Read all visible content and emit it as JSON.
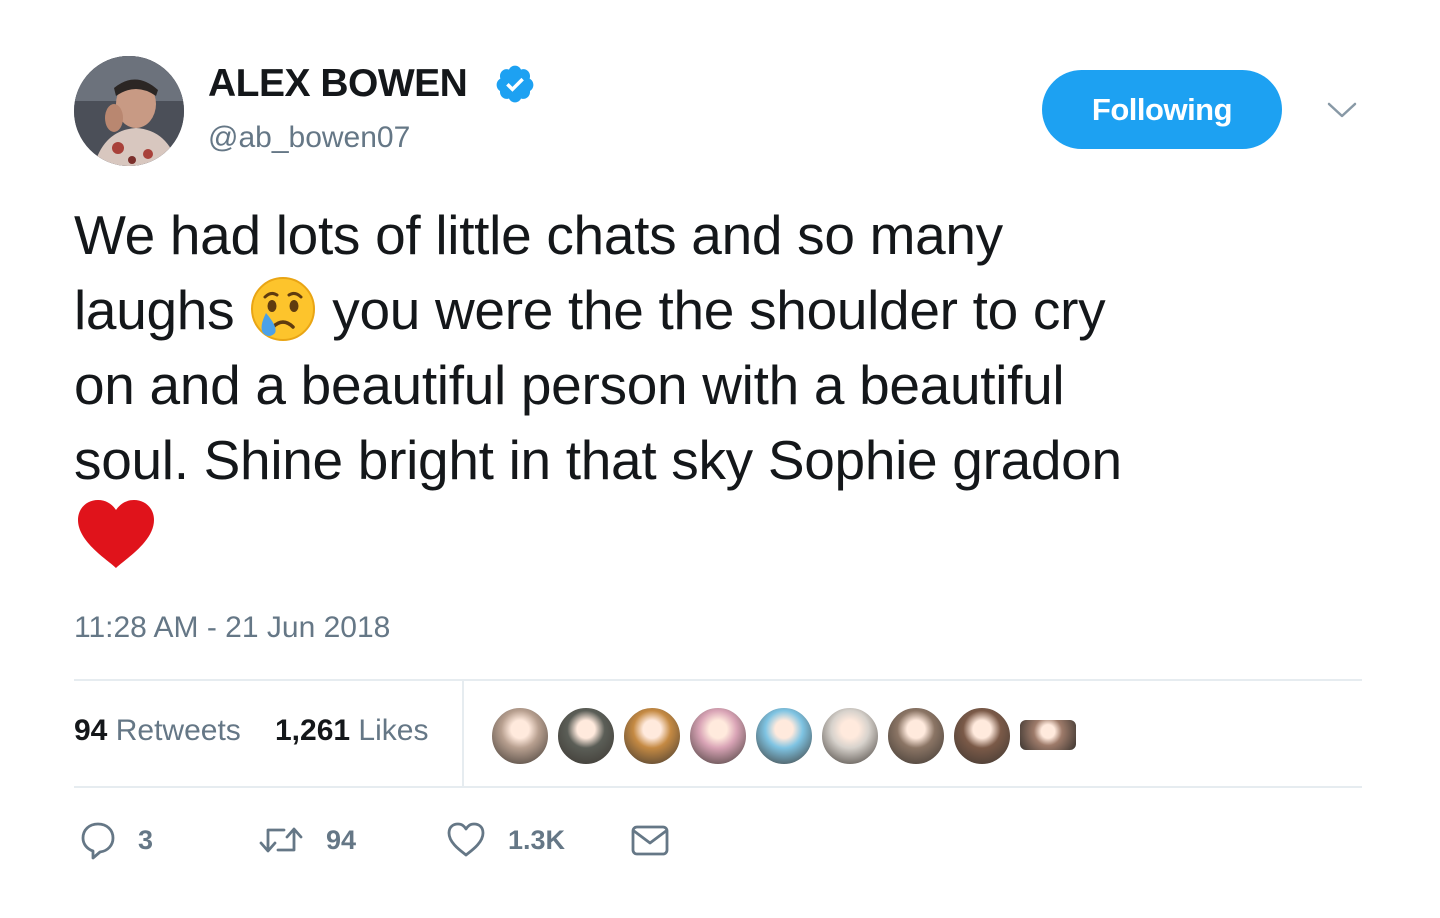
{
  "author": {
    "display_name": "ALEX BOWEN",
    "handle": "@ab_bowen07",
    "verified": true,
    "avatar_icon": "profile-photo"
  },
  "follow_button": {
    "label": "Following",
    "color": "#1da1f2"
  },
  "menu": {
    "icon": "chevron-down-icon"
  },
  "tweet": {
    "lines": [
      {
        "text": "We had lots of little chats and so many"
      },
      {
        "before": "laughs",
        "emoji": "crying-face-emoji",
        "after": "you were the the shoulder to cry"
      },
      {
        "text": "on and a beautiful person with a beautiful"
      },
      {
        "text": "soul. Shine bright in that sky Sophie gradon"
      },
      {
        "emoji": "red-heart-emoji"
      }
    ]
  },
  "timestamp": "11:28 AM - 21 Jun 2018",
  "stats": {
    "retweets_count": "94",
    "retweets_label": "Retweets",
    "likes_count": "1,261",
    "likes_label": "Likes"
  },
  "likers": [
    {
      "name": "liker-avatar-1",
      "color": "#b8a090"
    },
    {
      "name": "liker-avatar-2",
      "color": "#5b5e57"
    },
    {
      "name": "liker-avatar-3",
      "color": "#c58a43"
    },
    {
      "name": "liker-avatar-4",
      "color": "#d9a4b6"
    },
    {
      "name": "liker-avatar-5",
      "color": "#7fc4e3"
    },
    {
      "name": "liker-avatar-6",
      "color": "#d7d2cc"
    },
    {
      "name": "liker-avatar-7",
      "color": "#8b7565"
    },
    {
      "name": "liker-avatar-8",
      "color": "#7b5a48"
    },
    {
      "name": "liker-avatar-9",
      "color": "#9e7b6a"
    }
  ],
  "actions": {
    "reply_count": "3",
    "retweet_count": "94",
    "like_count": "1.3K",
    "icons": [
      "reply-icon",
      "retweet-icon",
      "like-icon",
      "direct-message-icon"
    ]
  },
  "colors": {
    "text": "#14171a",
    "secondary": "#657786",
    "divider": "#e6ecf0",
    "heart": "#e0131b"
  }
}
